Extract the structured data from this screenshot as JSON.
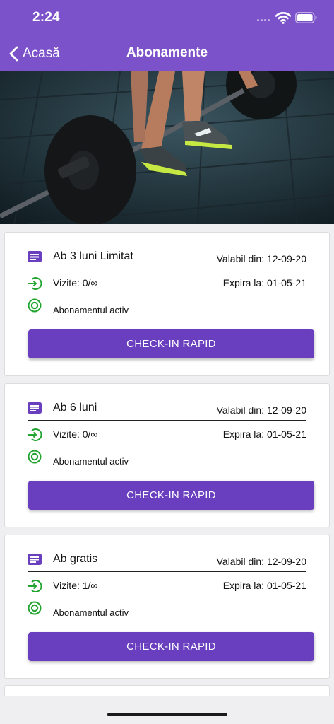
{
  "status_bar": {
    "time": "2:24"
  },
  "nav": {
    "back_label": "Acasă",
    "title": "Abonamente"
  },
  "colors": {
    "accent": "#7b52c9",
    "button": "#6a3fbf",
    "icon_green": "#23a330",
    "icon_purple": "#6a3fbf"
  },
  "subscriptions": [
    {
      "name": "Ab 3 luni Limitat",
      "valid_from": "Valabil din: 12-09-20",
      "visits": "Vizite: 0/∞",
      "expires": "Expira la: 01-05-21",
      "status": "Abonamentul activ",
      "button": "CHECK-IN RAPID"
    },
    {
      "name": "Ab 6 luni",
      "valid_from": "Valabil din: 12-09-20",
      "visits": "Vizite: 0/∞",
      "expires": "Expira la: 01-05-21",
      "status": "Abonamentul activ",
      "button": "CHECK-IN RAPID"
    },
    {
      "name": "Ab gratis",
      "valid_from": "Valabil din: 12-09-20",
      "visits": "Vizite: 1/∞",
      "expires": "Expira la: 01-05-21",
      "status": "Abonamentul activ",
      "button": "CHECK-IN RAPID"
    }
  ],
  "icons": {
    "back": "chevron-left-icon",
    "subscription": "document-icon",
    "visits": "check-in-arrow-icon",
    "status": "active-target-icon"
  }
}
